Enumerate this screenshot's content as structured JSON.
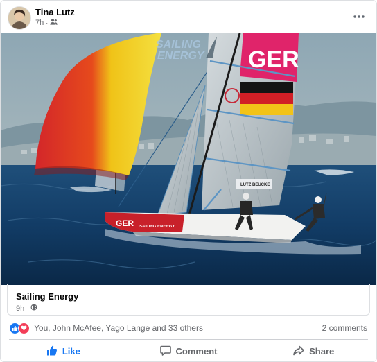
{
  "post": {
    "author": "Tina Lutz",
    "time": "7h",
    "audience_icon": "friends-icon"
  },
  "photo": {
    "watermark_line1": "SAILING",
    "watermark_line2": "ENERGY",
    "sail_text": "GER",
    "hull_text": "GER",
    "hull_logo": "SAILING ENERGY",
    "sail_number": "LUTZ BEUCKE"
  },
  "shared": {
    "title": "Sailing Energy",
    "time": "9h",
    "audience_icon": "globe-icon"
  },
  "reactions": {
    "types": [
      "like",
      "love"
    ],
    "text": "You, John McAfee, Yago Lange and 33 others",
    "comments": "2 comments"
  },
  "actions": {
    "like": "Like",
    "comment": "Comment",
    "share": "Share"
  },
  "colors": {
    "like_blue": "#1877f2",
    "love_red": "#f33e58",
    "secondary_text": "#65676b"
  }
}
